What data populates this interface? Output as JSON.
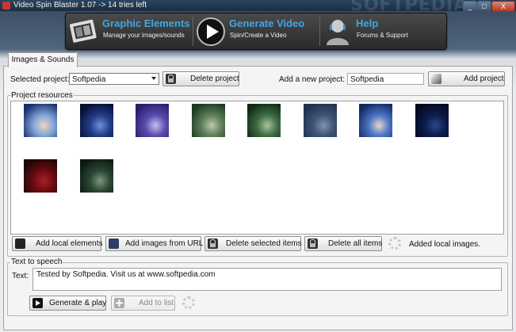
{
  "window": {
    "title": "Video Spin Blaster 1.07 -> 14 tries left",
    "watermark": "SOFTPEDIA",
    "minimize": "_",
    "maximize": "□",
    "close": "X"
  },
  "nav": [
    {
      "title": "Graphic Elements",
      "subtitle": "Manage your images/sounds",
      "icon": "film-strip-icon"
    },
    {
      "title": "Generate Video",
      "subtitle": "Spin/Create a Video",
      "icon": "play-icon"
    },
    {
      "title": "Help",
      "subtitle": "Forums & Support",
      "icon": "support-user-icon"
    }
  ],
  "tab": {
    "label": "Images & Sounds"
  },
  "project": {
    "selected_label": "Selected project:",
    "selected_value": "Softpedia",
    "delete_button": "Delete project",
    "add_label": "Add a new project:",
    "add_value": "Softpedia",
    "add_button": "Add project"
  },
  "resources": {
    "title": "Project resources",
    "thumbnails": [
      {
        "name": "image-blue-fairy-1",
        "colors": [
          "#1c2f6e",
          "#7fa6d9",
          "#f0d6c0"
        ]
      },
      {
        "name": "image-blue-fairy-2",
        "colors": [
          "#061032",
          "#223d8a",
          "#6f8fd6"
        ]
      },
      {
        "name": "image-purple-fantasy",
        "colors": [
          "#2a1f6a",
          "#5a4bb0",
          "#c4c2ef"
        ]
      },
      {
        "name": "image-green-forest-1",
        "colors": [
          "#1c3a22",
          "#5f7f5a",
          "#b9c9a8"
        ]
      },
      {
        "name": "image-green-forest-2",
        "colors": [
          "#0f2a18",
          "#3f6d45",
          "#a9c49d"
        ]
      },
      {
        "name": "image-softpedia-logo",
        "colors": [
          "#23324f",
          "#3f5576",
          "#8193ac"
        ]
      },
      {
        "name": "image-blue-fairy-3",
        "colors": [
          "#132a63",
          "#4d74c6",
          "#e7d6ca"
        ]
      },
      {
        "name": "image-dark-blue-text",
        "colors": [
          "#03081e",
          "#0d1d4d",
          "#2a4889"
        ]
      },
      {
        "name": "image-red-dark",
        "colors": [
          "#1f0505",
          "#6b0c10",
          "#a8222a"
        ]
      },
      {
        "name": "image-dark-forest",
        "colors": [
          "#0c1a12",
          "#2d4734",
          "#7e967f"
        ]
      }
    ]
  },
  "actions": {
    "add_local": "Add local elements",
    "add_url": "Add images from URL",
    "delete_selected": "Delete selected items",
    "delete_all": "Delete all items",
    "status": "Added local images."
  },
  "tts": {
    "title": "Text to speech",
    "text_label": "Text:",
    "text_value": "Tested by Softpedia. Visit us at www.softpedia.com",
    "generate_button": "Generate & play",
    "add_to_list_button": "Add to list"
  }
}
